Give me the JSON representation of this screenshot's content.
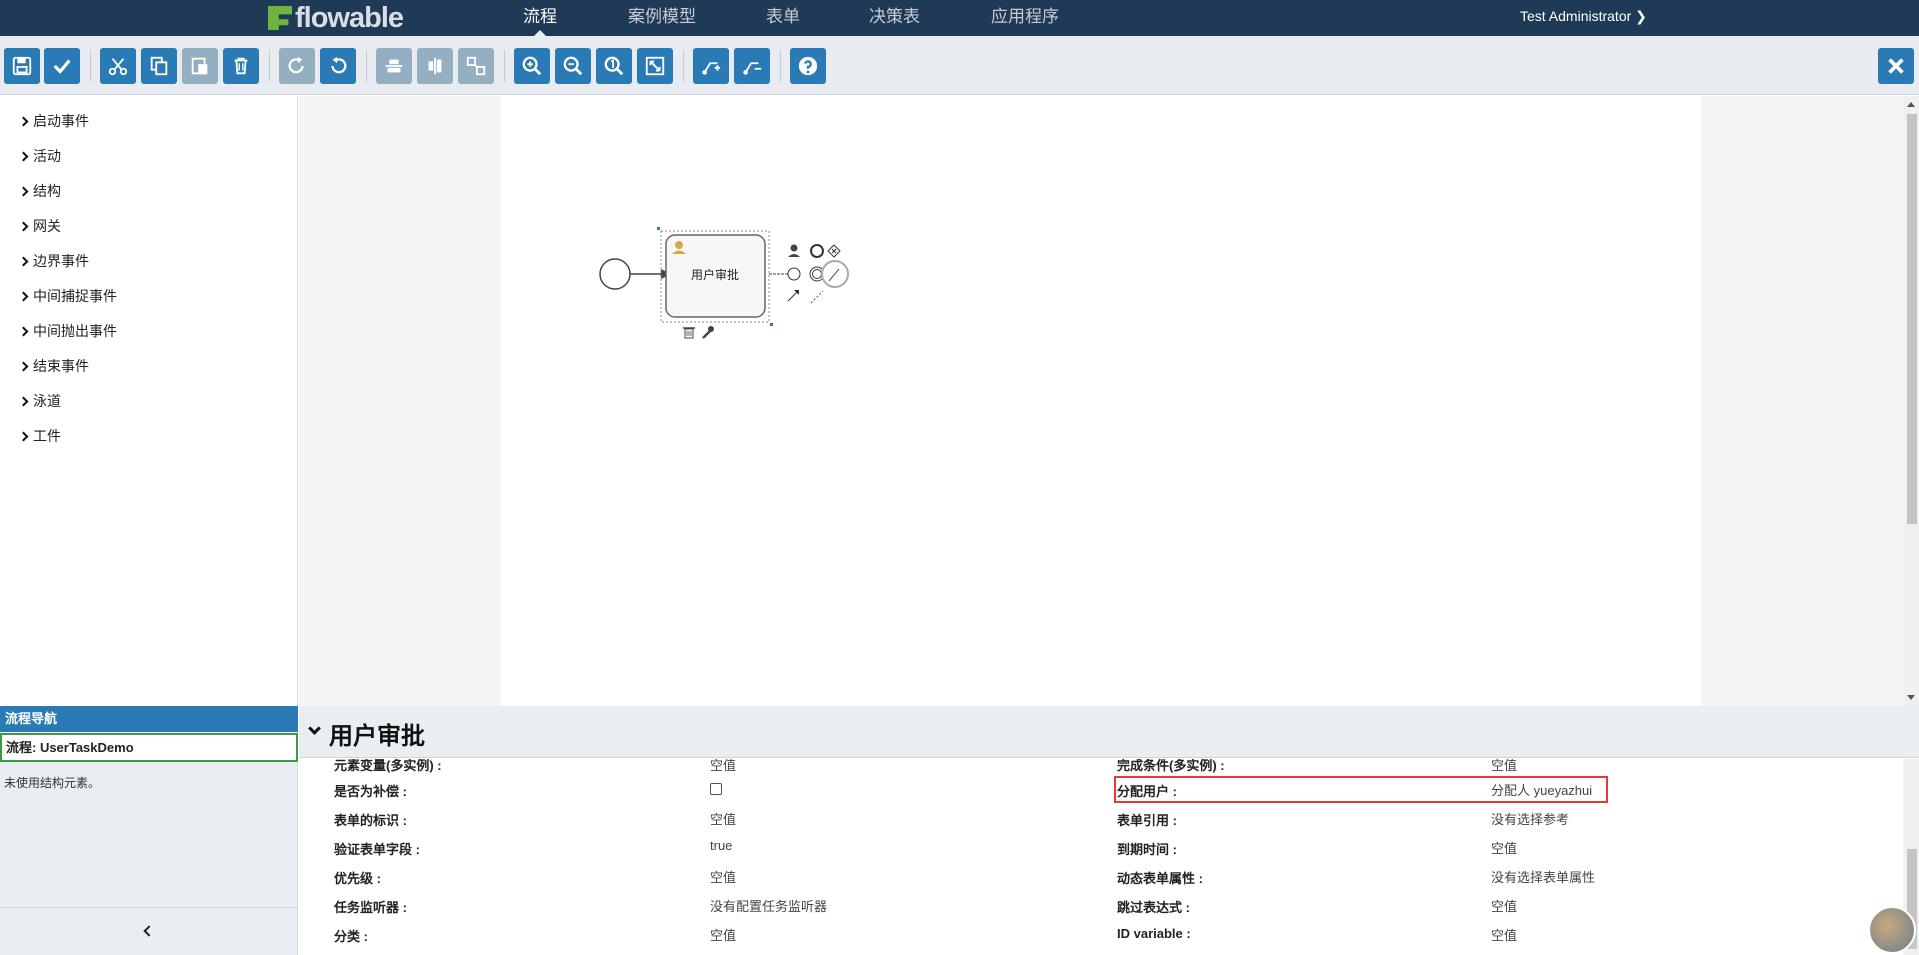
{
  "topnav": {
    "logo_text": "flowable",
    "items": [
      {
        "label": "流程",
        "active": true
      },
      {
        "label": "案例模型",
        "active": false
      },
      {
        "label": "表单",
        "active": false
      },
      {
        "label": "决策表",
        "active": false
      },
      {
        "label": "应用程序",
        "active": false
      }
    ],
    "user": "Test Administrator ❯"
  },
  "toolbar": {
    "buttons": [
      "save-icon",
      "validate-icon",
      "cut-icon",
      "copy-icon",
      "paste-icon",
      "delete-icon",
      "redo-icon",
      "undo-icon",
      "align-horizontal-icon",
      "align-vertical-icon",
      "same-size-icon",
      "zoom-in-icon",
      "zoom-out-icon",
      "zoom-actual-icon",
      "zoom-fit-icon",
      "bendpoint-add-icon",
      "bendpoint-remove-icon",
      "help-icon"
    ],
    "close_icon": "close-icon",
    "accent": "#2a7ab5"
  },
  "palette": {
    "items": [
      "启动事件",
      "活动",
      "结构",
      "网关",
      "边界事件",
      "中间捕捉事件",
      "中间抛出事件",
      "结束事件",
      "泳道",
      "工件"
    ]
  },
  "diagram": {
    "task_label": "用户审批"
  },
  "flow_nav": {
    "header": "流程导航",
    "process": "流程: UserTaskDemo",
    "note": "未使用结构元素。"
  },
  "props": {
    "title": "用户审批",
    "left": [
      {
        "label": "元素变量(多实例) :",
        "value": "空值"
      },
      {
        "label": "是否为补偿 :",
        "value": ""
      },
      {
        "label": "表单的标识 :",
        "value": "空值"
      },
      {
        "label": "验证表单字段 :",
        "value": "true"
      },
      {
        "label": "优先级 :",
        "value": "空值"
      },
      {
        "label": "任务监听器 :",
        "value": "没有配置任务监听器"
      },
      {
        "label": "分类 :",
        "value": "空值"
      }
    ],
    "right": [
      {
        "label": "完成条件(多实例) :",
        "value": "空值"
      },
      {
        "label": "分配用户 :",
        "value": "分配人 yueyazhui"
      },
      {
        "label": "表单引用 :",
        "value": "没有选择参考"
      },
      {
        "label": "到期时间 :",
        "value": "空值"
      },
      {
        "label": "动态表单属性 :",
        "value": "没有选择表单属性"
      },
      {
        "label": "跳过表达式 :",
        "value": "空值"
      },
      {
        "label": "ID variable :",
        "value": "空值"
      }
    ]
  }
}
